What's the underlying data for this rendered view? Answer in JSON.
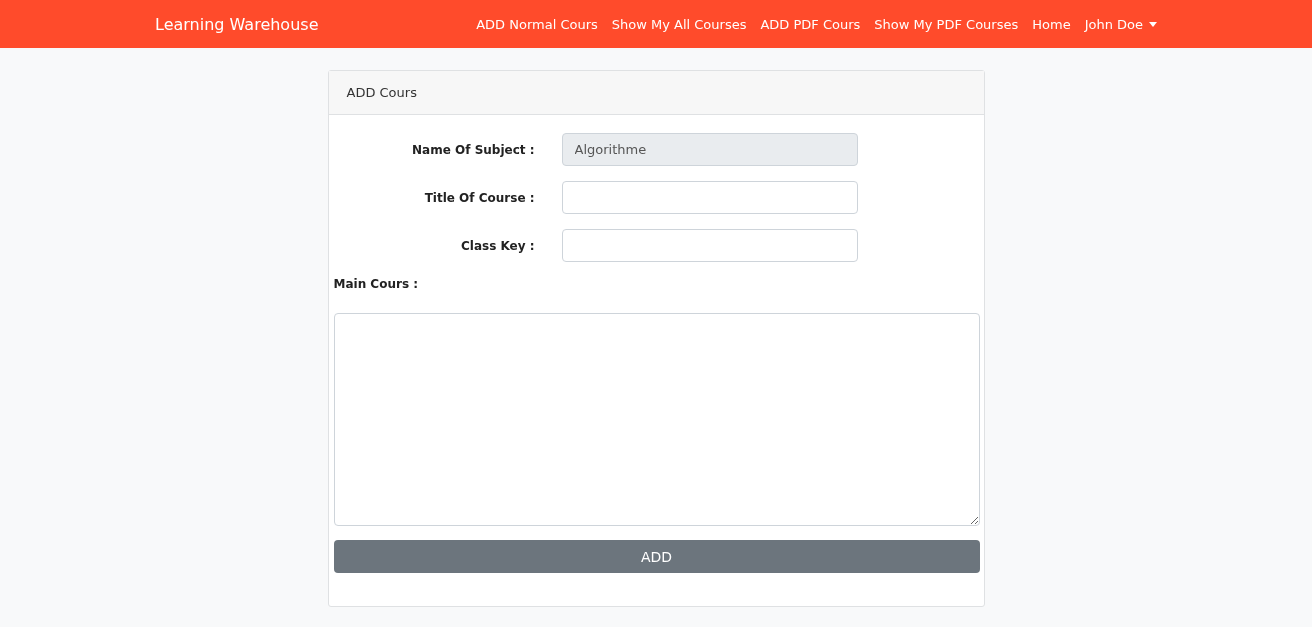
{
  "navbar": {
    "brand": "Learning Warehouse",
    "links": [
      {
        "label": "ADD Normal Cours"
      },
      {
        "label": "Show My All Courses"
      },
      {
        "label": "ADD PDF Cours"
      },
      {
        "label": "Show My PDF Courses"
      },
      {
        "label": "Home"
      }
    ],
    "user_menu": {
      "label": "John Doe"
    }
  },
  "card": {
    "title": "ADD Cours",
    "fields": [
      {
        "label": "Name Of Subject :",
        "value": "Algorithme",
        "disabled": true
      },
      {
        "label": "Title Of Course :",
        "disabled": false
      },
      {
        "label": "Class Key :",
        "disabled": false
      }
    ],
    "main_label": "Main Cours :",
    "submit": "ADD"
  }
}
